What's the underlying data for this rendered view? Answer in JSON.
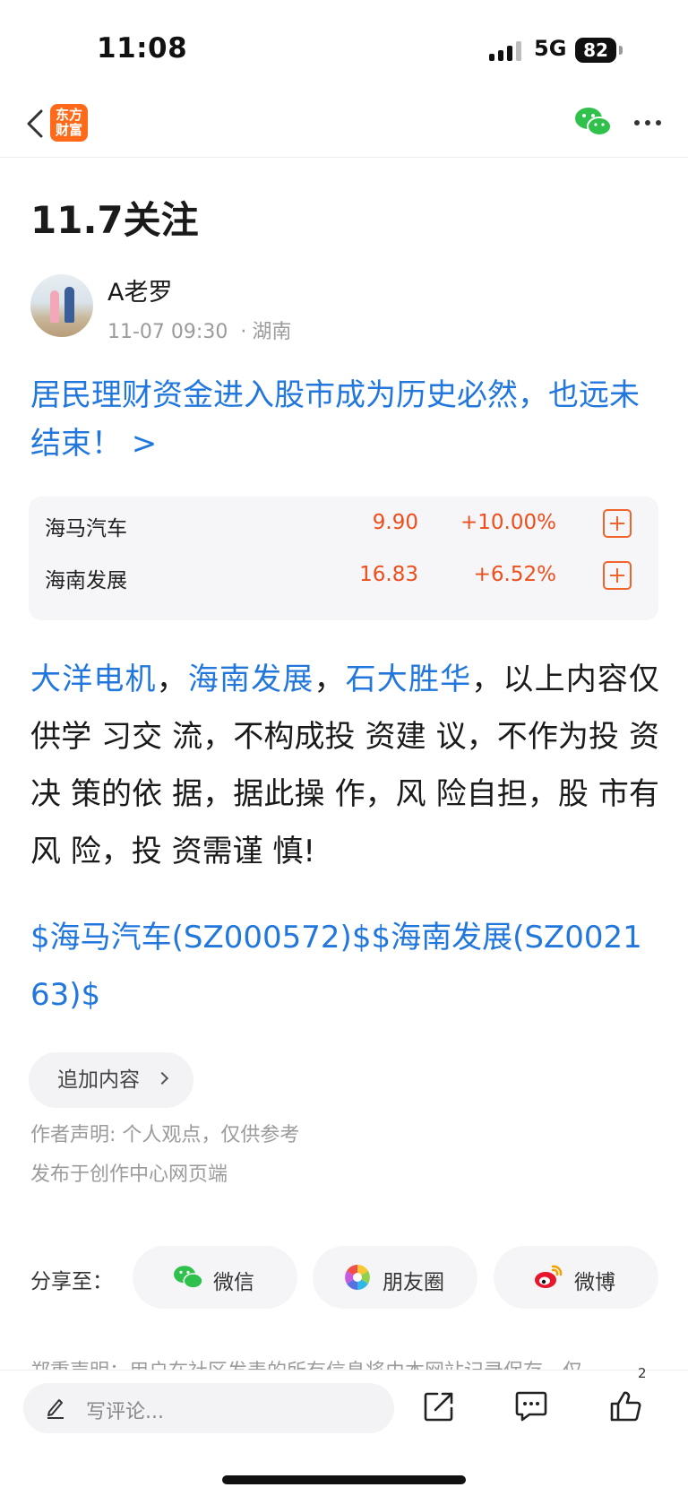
{
  "status_bar": {
    "time": "11:08",
    "network": "5G",
    "battery": "82"
  },
  "nav": {
    "logo_text_line1": "东方",
    "logo_text_line2": "财富"
  },
  "article": {
    "title": "11.7关注",
    "author": "A老罗",
    "datetime": "11-07 09:30",
    "location": "湖南",
    "headline": "居民理财资金进入股市成为历史必然，也远未结束！ >",
    "stocks": [
      {
        "name": "海马汽车",
        "price": "9.90",
        "change": "+10.00%"
      },
      {
        "name": "海南发展",
        "price": "16.83",
        "change": "+6.52%"
      }
    ],
    "body_links": [
      "大洋电机",
      "海南发展",
      "石大胜华"
    ],
    "body_sep": "，",
    "body_text": "，以上内容仅 供学 习交 流，不构成投 资建 议，不作为投 资决 策的依 据，据此操 作，风 险自担，股 市有风 险，投 资需谨 慎!",
    "tags": "$海马汽车(SZ000572)$$海南发展(SZ002163)$",
    "add_content_label": "追加内容",
    "author_statement": "作者声明: 个人观点，仅供参考",
    "publish_source": "发布于创作中心网页端"
  },
  "share": {
    "label": "分享至：",
    "buttons": [
      {
        "label": "微信",
        "icon": "wechat-icon"
      },
      {
        "label": "朋友圈",
        "icon": "moments-icon"
      },
      {
        "label": "微博",
        "icon": "weibo-icon"
      }
    ]
  },
  "disclaimer_partial": "郑重声明：用户在社区发表的所有信息将由本网站记录保存，仅",
  "bottom_bar": {
    "comment_placeholder": "写评论...",
    "like_count": "2"
  },
  "colors": {
    "link": "#2277dd",
    "up": "#ee4e1b",
    "brand": "#ff6a1a"
  }
}
